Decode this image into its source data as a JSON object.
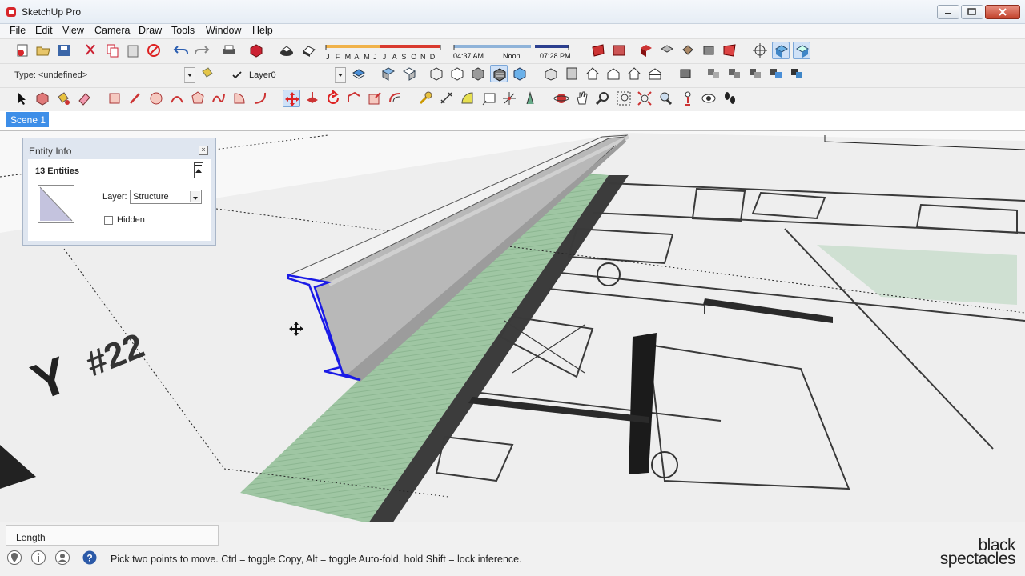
{
  "window": {
    "title": "SketchUp Pro"
  },
  "menu": [
    "File",
    "Edit",
    "View",
    "Camera",
    "Draw",
    "Tools",
    "Window",
    "Help"
  ],
  "toolbar": {
    "months": [
      "J",
      "F",
      "M",
      "A",
      "M",
      "J",
      "J",
      "A",
      "S",
      "O",
      "N",
      "D"
    ],
    "time_start": "04:37 AM",
    "time_mid": "Noon",
    "time_end": "07:28 PM",
    "type_label": "Type: <undefined>",
    "layer_current": "Layer0"
  },
  "scenes": {
    "tabs": [
      "Scene 1"
    ],
    "active": "Scene 1"
  },
  "entity_info": {
    "title": "Entity Info",
    "close_label": "×",
    "count": "13 Entities",
    "layer_label": "Layer:",
    "layer_value": "Structure",
    "hidden_label": "Hidden"
  },
  "drawing_text": {
    "left_label": "Y",
    "number_label": "#22"
  },
  "status": {
    "measure_label": "Length",
    "message": "Pick two points to move.  Ctrl = toggle Copy, Alt = toggle Auto-fold, hold Shift = lock inference."
  },
  "brand": {
    "line1": "black",
    "line2": "spectacles"
  },
  "colors": {
    "accent": "#3d8ee8",
    "selection_blue": "#1a1ae6",
    "green_strip": "#9fc6a3",
    "beam_face": "#bfbfbf",
    "titlebar": "#e9eef5"
  }
}
